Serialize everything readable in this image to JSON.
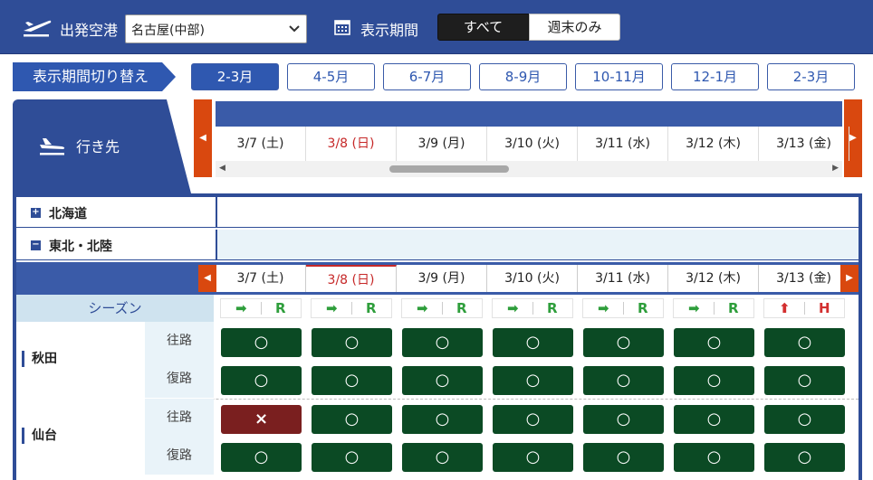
{
  "colors": {
    "primary": "#2f4d97",
    "accent": "#d9480f",
    "available": "#0b4a24",
    "unavailable": "#7a1f1f",
    "sunday": "#c62828"
  },
  "topbar": {
    "origin_label": "出発空港",
    "origin_value": "名古屋(中部)",
    "period_label": "表示期間",
    "segment_all": "すべて",
    "segment_weekend": "週末のみ"
  },
  "period": {
    "label": "表示期間切り替え",
    "tabs": [
      "2-3月",
      "4-5月",
      "6-7月",
      "8-9月",
      "10-11月",
      "12-1月",
      "2-3月"
    ],
    "active_index": 0
  },
  "destination": {
    "label": "行き先"
  },
  "dates": [
    "3/7 (土)",
    "3/8 (日)",
    "3/9 (月)",
    "3/10 (火)",
    "3/11 (水)",
    "3/12 (木)",
    "3/13 (金)"
  ],
  "sunday_index": 1,
  "regions": [
    {
      "name": "北海道",
      "toggle": "+",
      "expanded": false
    },
    {
      "name": "東北・北陸",
      "toggle": "−",
      "expanded": true
    }
  ],
  "season": {
    "label": "シーズン",
    "cells": [
      {
        "arrow": "➡",
        "letter": "R"
      },
      {
        "arrow": "➡",
        "letter": "R"
      },
      {
        "arrow": "➡",
        "letter": "R"
      },
      {
        "arrow": "➡",
        "letter": "R"
      },
      {
        "arrow": "➡",
        "letter": "R"
      },
      {
        "arrow": "➡",
        "letter": "R"
      },
      {
        "arrow": "⬆",
        "letter": "H"
      }
    ]
  },
  "cities": [
    {
      "name": "秋田",
      "rows": [
        {
          "dir": "往路",
          "cells": [
            "○",
            "○",
            "○",
            "○",
            "○",
            "○",
            "○"
          ]
        },
        {
          "dir": "復路",
          "cells": [
            "○",
            "○",
            "○",
            "○",
            "○",
            "○",
            "○"
          ]
        }
      ]
    },
    {
      "name": "仙台",
      "rows": [
        {
          "dir": "往路",
          "cells": [
            "×",
            "○",
            "○",
            "○",
            "○",
            "○",
            "○"
          ]
        },
        {
          "dir": "復路",
          "cells": [
            "○",
            "○",
            "○",
            "○",
            "○",
            "○",
            "○"
          ]
        }
      ]
    }
  ]
}
